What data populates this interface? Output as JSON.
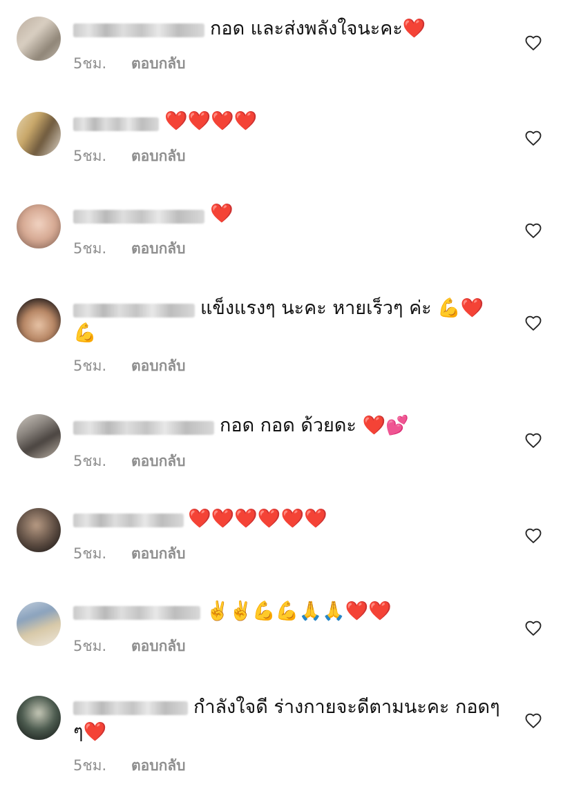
{
  "comments": [
    {
      "text": "กอด และส่งพลังใจนะคะ❤️",
      "cont": "",
      "time": "5ชม.",
      "reply": "ตอบกลับ"
    },
    {
      "text": "❤️❤️❤️❤️",
      "cont": "",
      "time": "5ชม.",
      "reply": "ตอบกลับ"
    },
    {
      "text": "❤️",
      "cont": "",
      "time": "5ชม.",
      "reply": "ตอบกลับ"
    },
    {
      "text": "แข็งแรงๆ นะคะ หายเร็วๆ ค่ะ 💪❤️",
      "cont": "💪",
      "time": "5ชม.",
      "reply": "ตอบกลับ"
    },
    {
      "text": "กอด กอด ด้วยดะ ❤️💕",
      "cont": "",
      "time": "5ชม.",
      "reply": "ตอบกลับ"
    },
    {
      "text": "❤️❤️❤️❤️❤️❤️",
      "cont": "",
      "time": "5ชม.",
      "reply": "ตอบกลับ"
    },
    {
      "text": "✌️✌️💪💪🙏🙏❤️❤️",
      "cont": "",
      "time": "5ชม.",
      "reply": "ตอบกลับ"
    },
    {
      "text": "กำลังใจดี ร่างกายจะดีตามนะคะ กอดๆ",
      "cont": "ๆ❤️",
      "time": "5ชม.",
      "reply": "ตอบกลับ"
    }
  ],
  "icons": {
    "like": "heart-outline-icon"
  },
  "colors": {
    "meta_text": "#8e8e8e",
    "heart_stroke": "#262626"
  }
}
